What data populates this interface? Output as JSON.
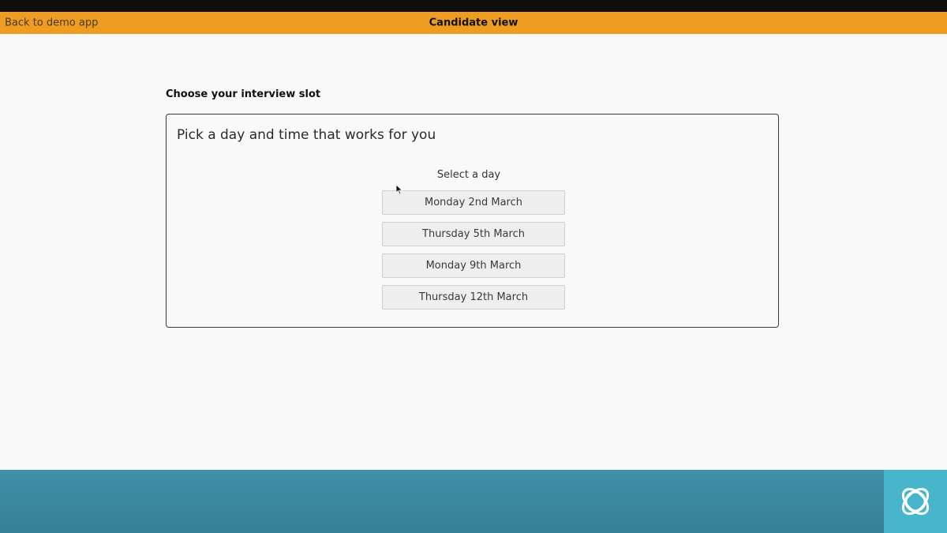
{
  "header": {
    "back_link": "Back to demo app",
    "title": "Candidate view"
  },
  "main": {
    "section_title": "Choose your interview slot",
    "card": {
      "heading": "Pick a day and time that works for you",
      "select_label": "Select a day",
      "days": [
        {
          "label": "Monday 2nd March"
        },
        {
          "label": "Thursday 5th March"
        },
        {
          "label": "Monday 9th March"
        },
        {
          "label": "Thursday 12th March"
        }
      ]
    }
  },
  "footer": {
    "logo_icon": "orbital-logo-icon"
  },
  "colors": {
    "header_accent": "#ef9c22",
    "footer_bar": "#3a88a0",
    "logo_tile": "#47b6cd"
  }
}
